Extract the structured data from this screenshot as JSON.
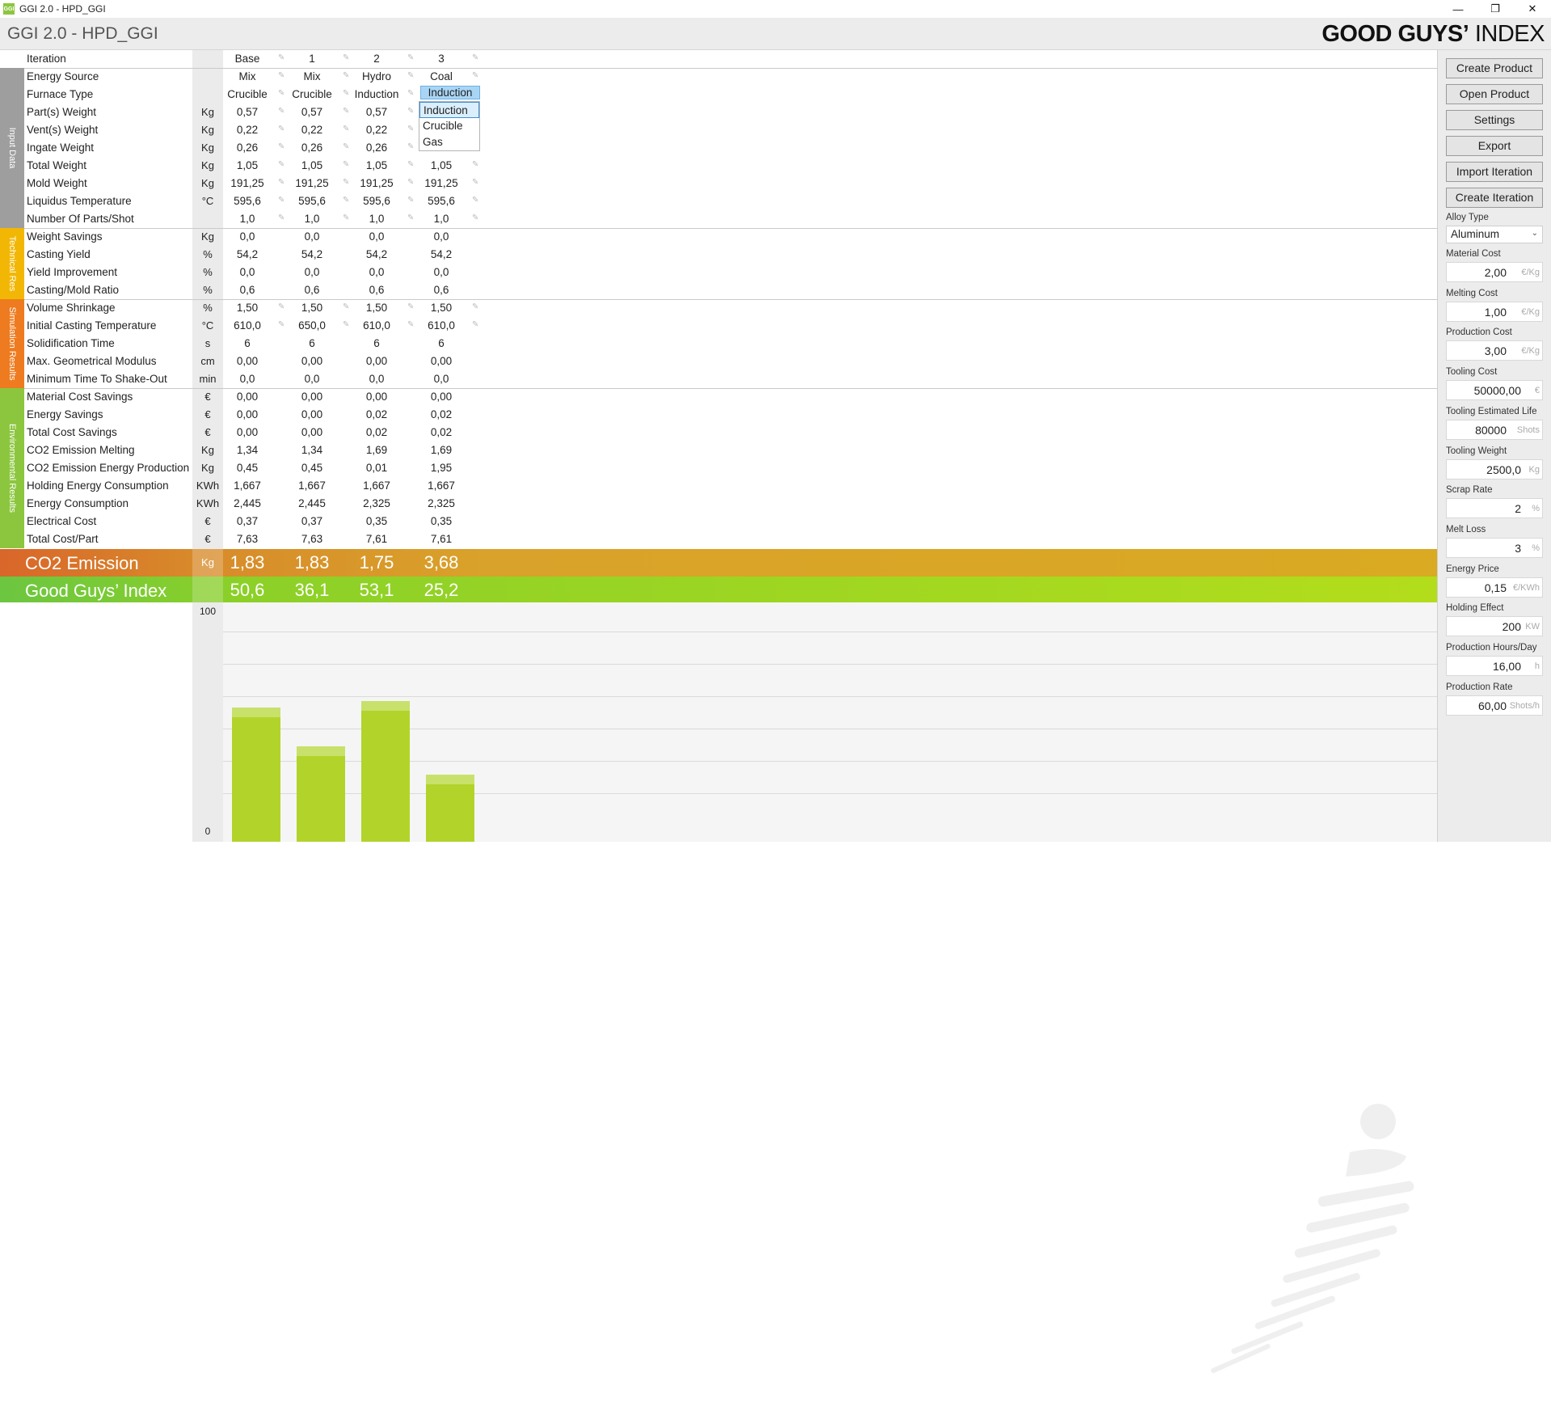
{
  "window": {
    "title": "GGI 2.0 - HPD_GGI",
    "icon_text": "GGI"
  },
  "header": {
    "title": "GGI 2.0 - HPD_GGI",
    "brand_bold": "GOOD GUYS’",
    "brand_light": "INDEX"
  },
  "columns": [
    "Base",
    "1",
    "2",
    "3"
  ],
  "sections": [
    {
      "name": "Input Data",
      "color": "#9e9e9e"
    },
    {
      "name": "Technical Res",
      "color": "#f2b705"
    },
    {
      "name": "Simulation Results",
      "color": "#ee7b1f"
    },
    {
      "name": "Environmental Results",
      "color": "#8cc63f"
    }
  ],
  "rows": [
    {
      "label": "Iteration",
      "unit": "",
      "values": [
        "Base",
        "1",
        "2",
        "3"
      ]
    },
    {
      "label": "Energy Source",
      "unit": "",
      "values": [
        "Mix",
        "Mix",
        "Hydro",
        "Coal"
      ]
    },
    {
      "label": "Furnace Type",
      "unit": "",
      "values": [
        "Crucible",
        "Crucible",
        "Induction",
        ""
      ]
    },
    {
      "label": "Part(s) Weight",
      "unit": "Kg",
      "values": [
        "0,57",
        "0,57",
        "0,57",
        ""
      ]
    },
    {
      "label": "Vent(s) Weight",
      "unit": "Kg",
      "values": [
        "0,22",
        "0,22",
        "0,22",
        ""
      ]
    },
    {
      "label": "Ingate Weight",
      "unit": "Kg",
      "values": [
        "0,26",
        "0,26",
        "0,26",
        ""
      ]
    },
    {
      "label": "Total Weight",
      "unit": "Kg",
      "values": [
        "1,05",
        "1,05",
        "1,05",
        "1,05"
      ]
    },
    {
      "label": "Mold Weight",
      "unit": "Kg",
      "values": [
        "191,25",
        "191,25",
        "191,25",
        "191,25"
      ]
    },
    {
      "label": "Liquidus Temperature",
      "unit": "°C",
      "values": [
        "595,6",
        "595,6",
        "595,6",
        "595,6"
      ]
    },
    {
      "label": "Number Of Parts/Shot",
      "unit": "",
      "values": [
        "1,0",
        "1,0",
        "1,0",
        "1,0"
      ]
    },
    {
      "label": "Weight Savings",
      "unit": "Kg",
      "values": [
        "0,0",
        "0,0",
        "0,0",
        "0,0"
      ]
    },
    {
      "label": "Casting Yield",
      "unit": "%",
      "values": [
        "54,2",
        "54,2",
        "54,2",
        "54,2"
      ]
    },
    {
      "label": "Yield Improvement",
      "unit": "%",
      "values": [
        "0,0",
        "0,0",
        "0,0",
        "0,0"
      ]
    },
    {
      "label": "Casting/Mold Ratio",
      "unit": "%",
      "values": [
        "0,6",
        "0,6",
        "0,6",
        "0,6"
      ]
    },
    {
      "label": "Volume Shrinkage",
      "unit": "%",
      "values": [
        "1,50",
        "1,50",
        "1,50",
        "1,50"
      ]
    },
    {
      "label": "Initial Casting Temperature",
      "unit": "°C",
      "values": [
        "610,0",
        "650,0",
        "610,0",
        "610,0"
      ]
    },
    {
      "label": "Solidification Time",
      "unit": "s",
      "values": [
        "6",
        "6",
        "6",
        "6"
      ]
    },
    {
      "label": "Max. Geometrical Modulus",
      "unit": "cm",
      "values": [
        "0,00",
        "0,00",
        "0,00",
        "0,00"
      ]
    },
    {
      "label": "Minimum Time To Shake-Out",
      "unit": "min",
      "values": [
        "0,0",
        "0,0",
        "0,0",
        "0,0"
      ]
    },
    {
      "label": "Material Cost Savings",
      "unit": "€",
      "values": [
        "0,00",
        "0,00",
        "0,00",
        "0,00"
      ]
    },
    {
      "label": "Energy Savings",
      "unit": "€",
      "values": [
        "0,00",
        "0,00",
        "0,02",
        "0,02"
      ]
    },
    {
      "label": "Total Cost Savings",
      "unit": "€",
      "values": [
        "0,00",
        "0,00",
        "0,02",
        "0,02"
      ]
    },
    {
      "label": "CO2 Emission Melting",
      "unit": "Kg",
      "values": [
        "1,34",
        "1,34",
        "1,69",
        "1,69"
      ]
    },
    {
      "label": "CO2 Emission Energy Production",
      "unit": "Kg",
      "values": [
        "0,45",
        "0,45",
        "0,01",
        "1,95"
      ]
    },
    {
      "label": "Holding Energy Consumption",
      "unit": "KWh",
      "values": [
        "1,667",
        "1,667",
        "1,667",
        "1,667"
      ]
    },
    {
      "label": "Energy Consumption",
      "unit": "KWh",
      "values": [
        "2,445",
        "2,445",
        "2,325",
        "2,325"
      ]
    },
    {
      "label": "Electrical Cost",
      "unit": "€",
      "values": [
        "0,37",
        "0,37",
        "0,35",
        "0,35"
      ]
    },
    {
      "label": "Total Cost/Part",
      "unit": "€",
      "values": [
        "7,63",
        "7,63",
        "7,61",
        "7,61"
      ]
    }
  ],
  "co2": {
    "label": "CO2 Emission",
    "unit": "Kg",
    "values": [
      "1,83",
      "1,83",
      "1,75",
      "3,68"
    ]
  },
  "ggi": {
    "label": "Good Guys’ Index",
    "values": [
      "50,6",
      "36,1",
      "53,1",
      "25,2"
    ]
  },
  "dropdown": {
    "current": "Induction",
    "options": [
      "Induction",
      "Crucible",
      "Gas"
    ],
    "selected": "Induction"
  },
  "chart_data": {
    "type": "bar",
    "categories": [
      "Base",
      "1",
      "2",
      "3"
    ],
    "values": [
      50.6,
      36.1,
      53.1,
      25.2
    ],
    "ylim": [
      0,
      100
    ],
    "y_ticks": [
      "100",
      "0"
    ],
    "color": "#b2d42a"
  },
  "panel": {
    "buttons": [
      "Create Product",
      "Open Product",
      "Settings",
      "Export",
      "Import Iteration",
      "Create Iteration"
    ],
    "alloy": {
      "label": "Alloy Type",
      "value": "Aluminum"
    },
    "fields": [
      {
        "label": "Material Cost",
        "value": "2,00",
        "unit": "€/Kg"
      },
      {
        "label": "Melting Cost",
        "value": "1,00",
        "unit": "€/Kg"
      },
      {
        "label": "Production Cost",
        "value": "3,00",
        "unit": "€/Kg"
      },
      {
        "label": "Tooling Cost",
        "value": "50000,00",
        "unit": "€"
      },
      {
        "label": "Tooling Estimated Life",
        "value": "80000",
        "unit": "Shots"
      },
      {
        "label": "Tooling Weight",
        "value": "2500,0",
        "unit": "Kg"
      },
      {
        "label": "Scrap Rate",
        "value": "2",
        "unit": "%"
      },
      {
        "label": "Melt Loss",
        "value": "3",
        "unit": "%"
      },
      {
        "label": "Energy Price",
        "value": "0,15",
        "unit": "€/KWh"
      },
      {
        "label": "Holding Effect",
        "value": "200",
        "unit": "KW"
      },
      {
        "label": "Production Hours/Day",
        "value": "16,00",
        "unit": "h"
      },
      {
        "label": "Production Rate",
        "value": "60,00",
        "unit": "Shots/h"
      }
    ]
  }
}
